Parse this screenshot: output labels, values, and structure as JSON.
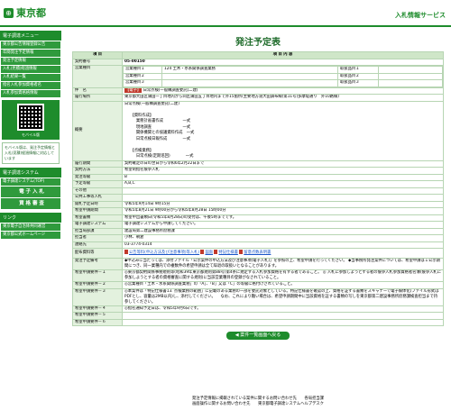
{
  "header": {
    "logo_text": "東京都",
    "service": "入札情報サービス"
  },
  "sidebar": {
    "section1": "電子調達メニュー",
    "items1": [
      "東京都公告情報登録公告",
      "年間発注予定情報",
      "発注予定情報",
      "入札(見積)経過情報",
      "入札結果一覧",
      "指名入札参加資格者名",
      "入札参加資格格情報"
    ],
    "qr_label": "モバイル版",
    "qr_note": "モバイル版は、発注予定情報と入札(見積)経過情報に対応しています",
    "section2": "電子調達システム",
    "items2": [
      "電子調達システム(TOP)",
      "電 子 入 札",
      "資 格 審 査"
    ],
    "section3": "リンク",
    "items3": [
      "東京電子自治体共同運営",
      "東京都公式ホームページ"
    ]
  },
  "page": {
    "title": "発注予定表",
    "col_item": "項 目",
    "col_content": "項 目 内 容",
    "rows": {
      "contract_no": {
        "label": "契約番号",
        "value": "05-00150"
      },
      "category": {
        "label": "営業種目",
        "entries": [
          {
            "name": "営業種目１",
            "value": "124 土木・水系関係調査業務",
            "rank_label": "取扱品目１"
          },
          {
            "name": "営業種目２",
            "value": "",
            "rank_label": "取扱品目２"
          },
          {
            "name": "営業種目３",
            "value": "",
            "rank_label": "取扱品目３"
          }
        ]
      },
      "name": {
        "label": "件　名",
        "tag": "【電子】",
        "value": "日常点検(一般構調査委託(二建)"
      },
      "place": {
        "label": "履行場所",
        "value": "東京都大田区蒲田一丁目地内から同区蒲田五丁目地内まで外15箇所(主要地方道大田調布線(第11号)多摩堤通り　外10路線)"
      },
      "summary": {
        "label": "概要",
        "value": "日常点検(一般構調査委託(二建)\n\n　　【資料作成】\n　　　業務計画書作成　　　　　一式\n　　　現地調査　　　　　　　　一式\n　　　関係機関との協議資料作成　一式\n　　　日常点検日報作成　　　　一式\n\n　　【点検業務】\n　　　日常点検(定期巡回)　　　　一式"
      },
      "period": {
        "label": "履行期間",
        "value": "契約確定の日の翌日から令和6年2月22日まで"
      },
      "method": {
        "label": "契約方法",
        "value": "希望制指名競争入札"
      },
      "rank": {
        "label": "発注等級",
        "value": "B"
      },
      "bid_rank": {
        "label": "予定等級",
        "value": "A,B,C"
      },
      "other": {
        "label": "その他",
        "value": ""
      },
      "bid_method": {
        "label": "公共工事等入札",
        "value": ""
      },
      "open_date": {
        "label": "開札予定日時",
        "value": "令和5年9月14日 9時15分"
      },
      "apply_period": {
        "label": "希望申請期間",
        "value": "令和5年8月21日 9時00分から令和5年8月28日 15時00分"
      },
      "apply_limit": {
        "label": "希望書類",
        "value": "希望申出書類日(令和5年8月28日)の受付は、午後5時までです。"
      },
      "system": {
        "label": "電子調達システム",
        "value": "電子調達システムから申請してください。"
      },
      "dept": {
        "label": "担当局部課",
        "value": "建設局第二建設事務所庶務課"
      },
      "person": {
        "label": "担当者",
        "value": "小林、朝倉"
      },
      "phone": {
        "label": "連絡先",
        "value": "03-3774-0314"
      },
      "docs": {
        "label": "配布資料等",
        "links": [
          "公告等料(申込方法及び注意事項)等入札)",
          "図面",
          "特記仕様書",
          "留意点数表明書"
        ]
      },
      "notes": {
        "label": "発注予定備考",
        "value": "◆申込みに当たっては、添付ファイル「公示案件の申込方法及び注意事項(電子入札)」を参照の上、希望申請を行ってください。\n◆当事務所発注案件については、希望申請は１公示期間につき、同一業種内での複数件の希望申請は全て辞退の取扱いとなることがあります。"
      },
      "cond1": {
        "label": "希望申請要件－１",
        "value": "◎東京都契約関係事務規則等(昭和39年東京都規則第88号)第4条に規定する入札参加資格を有する者であること。\n◎ 入札に参加しようとする者の競争入札参加資格者名簿(競争入札に参加しようとする者の資格審査に関する規則)に当該営業種目の登録がなされていること。"
      },
      "cond2": {
        "label": "希望申請要件－２",
        "value": "◎営業種目「土木・水系関係調査業務」の「A」、「B」又は「C」の等級に格付けされていること。"
      },
      "cond3": {
        "label": "希望申請要件－３",
        "value": "◎本案件は「特記仕様書13. 点検業務の範囲」に記載のある業務の一部を委託対象としている。特記仕様書を確認の上、資格を証する書類をスキャナーで電子媒体化(ファイル形式はPDFとし、容量は2MB以内)し、添付してください。\n　なお、これにより難い場合は、希望申請期間中に当該資格を証する書類の写しを東京都第二建設事務所庶務課検査担当まで持参してください。"
      },
      "cond4": {
        "label": "希望申請要件－４",
        "value": "◎指名通知予定日は、令和5年9月6日です。"
      },
      "cond5": {
        "label": "希望申請要件－５",
        "value": ""
      },
      "cond6": {
        "label": "希望申請要件－６",
        "value": ""
      }
    },
    "back_button": "案件一覧画面へ戻る"
  },
  "footer": {
    "line1": "発注予定情報に掲載されている案件に関するお問い合わせ先　　各局担当課",
    "line2": "画面操作に関するお問い合わせ先　　東京都電子調達システムヘルプデスク"
  }
}
